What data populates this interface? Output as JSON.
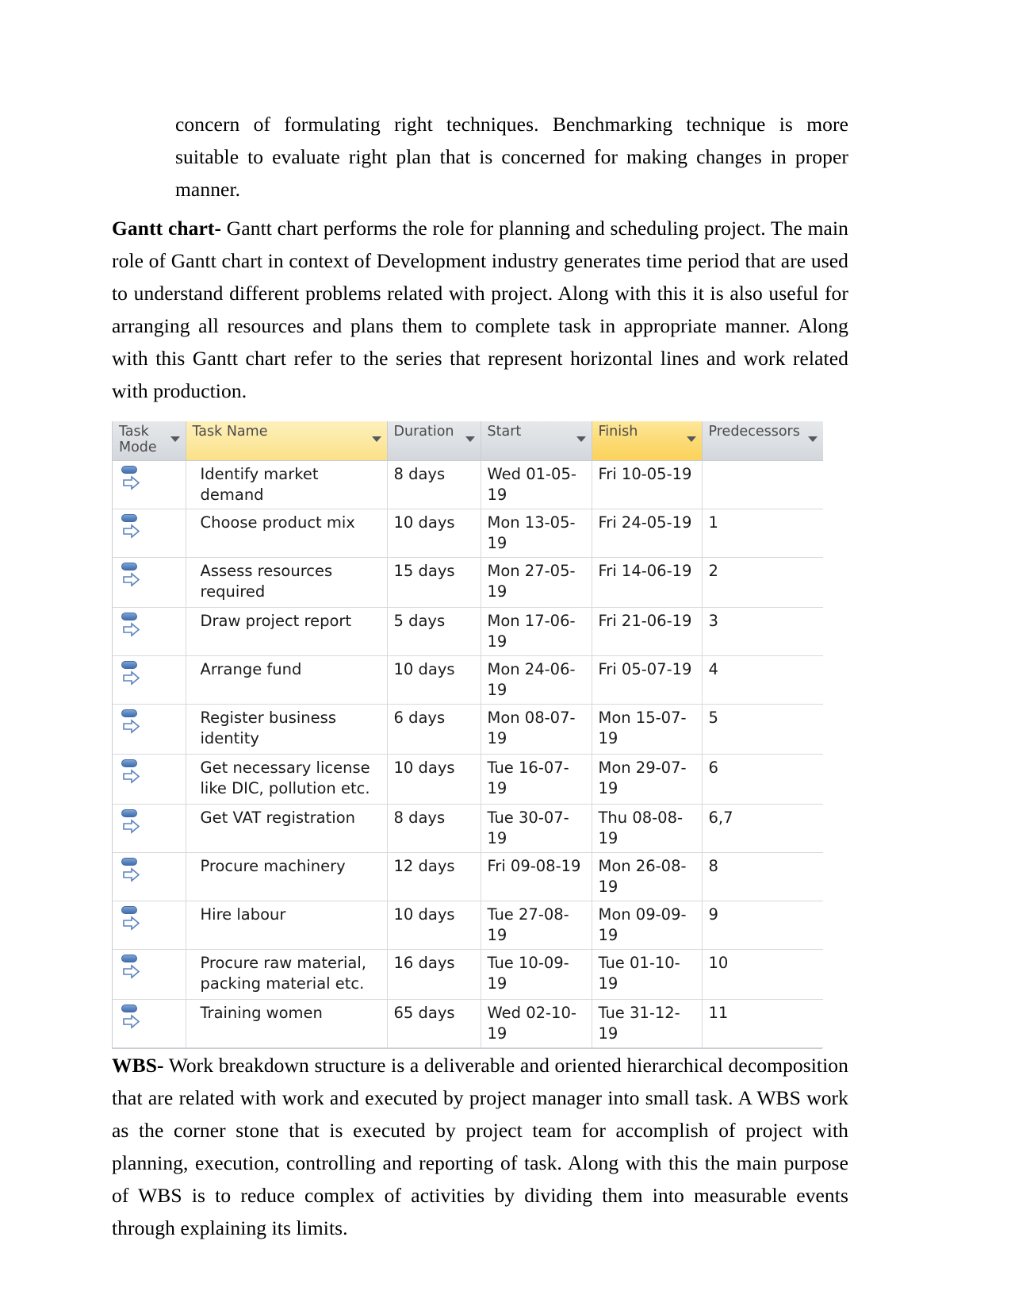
{
  "document": {
    "paragraph_top": {
      "text": "concern of formulating right techniques. Benchmarking technique is more suitable to evaluate right plan that is concerned for making changes in proper manner."
    },
    "gantt_section": {
      "lead": "Gantt chart-",
      "text": " Gantt chart performs the role for planning and scheduling project. The main role of Gantt chart in context of Development industry generates time period that are used to understand different problems related with project. Along with this it is also useful for arranging all resources and plans them to complete task in appropriate manner. Along with this Gantt chart refer to the series that represent horizontal lines and work related with production."
    },
    "wbs_section": {
      "lead": "WBS-",
      "text": "  Work breakdown structure is a deliverable and oriented hierarchical decomposition that are related with work and executed by project manager into small task. A WBS work as the corner stone that is executed by project team for accomplish of project with planning, execution, controlling and reporting of task. Along with this the main purpose of WBS is to reduce complex of activities by dividing them into measurable events through explaining its limits."
    }
  },
  "chart_data": {
    "type": "table",
    "title": "Gantt chart task schedule",
    "columns": [
      "Task Mode",
      "Task Name",
      "Duration",
      "Start",
      "Finish",
      "Predecessors"
    ],
    "header": {
      "task_mode_line1": "Task",
      "task_mode_line2": "Mode",
      "task_name": "Task Name",
      "duration": "Duration",
      "start": "Start",
      "finish": "Finish",
      "predecessors": "Predecessors"
    },
    "highlighted_columns": [
      "Task Name",
      "Finish"
    ],
    "highlight_color": "#fbd25c",
    "header_color": "#dcdfe3",
    "rows": [
      {
        "mode": "auto-scheduled-icon",
        "name": "Identify market demand",
        "duration": "8 days",
        "start": "Wed 01-05-19",
        "finish": "Fri 10-05-19",
        "predecessors": ""
      },
      {
        "mode": "auto-scheduled-icon",
        "name": "Choose product mix",
        "duration": "10 days",
        "start": "Mon 13-05-19",
        "finish": "Fri 24-05-19",
        "predecessors": "1"
      },
      {
        "mode": "auto-scheduled-icon",
        "name": "Assess resources required",
        "duration": "15 days",
        "start": "Mon 27-05-19",
        "finish": "Fri 14-06-19",
        "predecessors": "2"
      },
      {
        "mode": "auto-scheduled-icon",
        "name": "Draw project report",
        "duration": "5 days",
        "start": "Mon 17-06-19",
        "finish": "Fri 21-06-19",
        "predecessors": "3"
      },
      {
        "mode": "auto-scheduled-icon",
        "name": "Arrange fund",
        "duration": "10 days",
        "start": "Mon 24-06-19",
        "finish": "Fri 05-07-19",
        "predecessors": "4"
      },
      {
        "mode": "auto-scheduled-icon",
        "name": "Register business identity",
        "duration": "6 days",
        "start": "Mon 08-07-19",
        "finish": "Mon 15-07-19",
        "predecessors": "5"
      },
      {
        "mode": "auto-scheduled-icon",
        "name": "Get necessary license like DIC, pollution etc.",
        "duration": "10 days",
        "start": "Tue 16-07-19",
        "finish": "Mon 29-07-19",
        "predecessors": "6"
      },
      {
        "mode": "auto-scheduled-icon",
        "name": "Get VAT registration",
        "duration": "8 days",
        "start": "Tue 30-07-19",
        "finish": "Thu 08-08-19",
        "predecessors": "6,7"
      },
      {
        "mode": "auto-scheduled-icon",
        "name": "Procure machinery",
        "duration": "12 days",
        "start": "Fri 09-08-19",
        "finish": "Mon 26-08-19",
        "predecessors": "8"
      },
      {
        "mode": "auto-scheduled-icon",
        "name": "Hire labour",
        "duration": "10 days",
        "start": "Tue 27-08-19",
        "finish": "Mon 09-09-19",
        "predecessors": "9"
      },
      {
        "mode": "auto-scheduled-icon",
        "name": "Procure raw material, packing material etc.",
        "duration": "16 days",
        "start": "Tue 10-09-19",
        "finish": "Tue 01-10-19",
        "predecessors": "10"
      },
      {
        "mode": "auto-scheduled-icon",
        "name": "Training women",
        "duration": "65 days",
        "start": "Wed 02-10-19",
        "finish": "Tue 31-12-19",
        "predecessors": "11"
      }
    ]
  }
}
